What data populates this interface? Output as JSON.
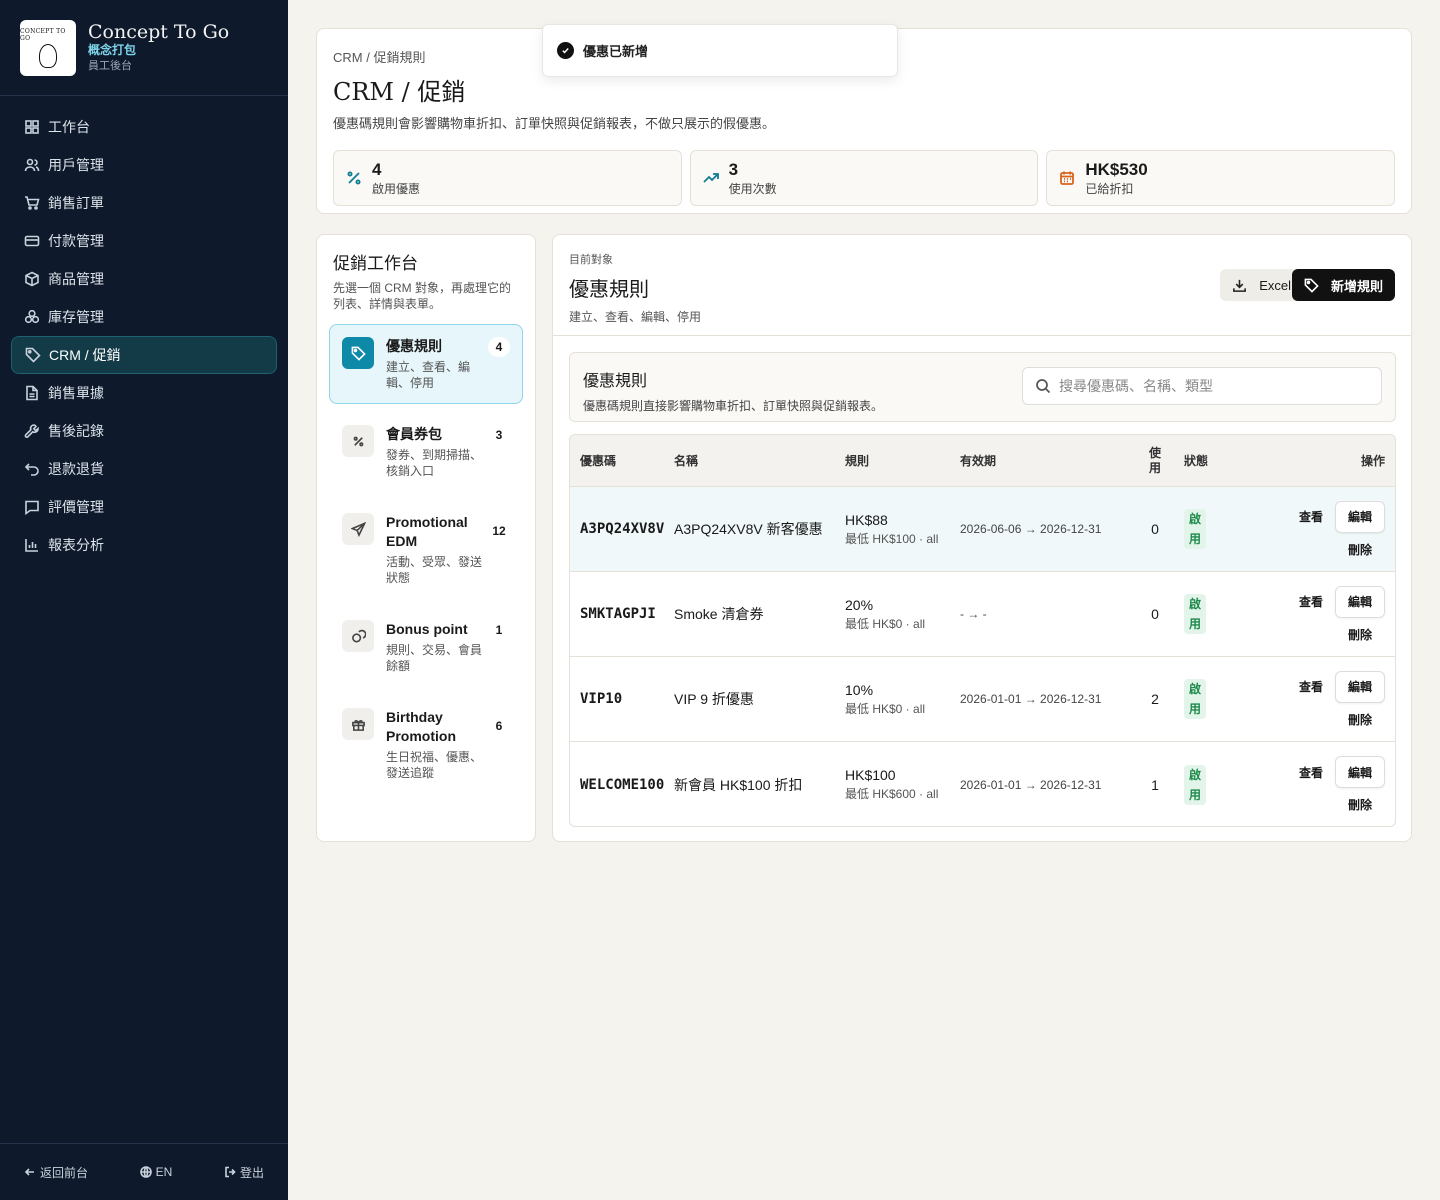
{
  "brand": {
    "logo_text": "CONCEPT TO GO",
    "title": "Concept To Go",
    "subtitle": "概念打包",
    "caption": "員工後台"
  },
  "nav": [
    {
      "label": "工作台",
      "icon": "dashboard-icon"
    },
    {
      "label": "用戶管理",
      "icon": "users-icon"
    },
    {
      "label": "銷售訂單",
      "icon": "cart-icon"
    },
    {
      "label": "付款管理",
      "icon": "credit-card-icon"
    },
    {
      "label": "商品管理",
      "icon": "package-icon"
    },
    {
      "label": "庫存管理",
      "icon": "boxes-icon"
    },
    {
      "label": "CRM / 促銷",
      "icon": "tag-icon",
      "active": true
    },
    {
      "label": "銷售單據",
      "icon": "file-icon"
    },
    {
      "label": "售後記錄",
      "icon": "wrench-icon"
    },
    {
      "label": "退款退貨",
      "icon": "undo-icon"
    },
    {
      "label": "評價管理",
      "icon": "message-icon"
    },
    {
      "label": "報表分析",
      "icon": "bar-chart-icon"
    }
  ],
  "footer": {
    "back": "返回前台",
    "lang": "EN",
    "logout": "登出"
  },
  "toast": {
    "message": "優惠已新增"
  },
  "header": {
    "breadcrumb": "CRM / 促銷規則",
    "title": "CRM / 促銷",
    "desc": "優惠碼規則會影響購物車折扣、訂單快照與促銷報表，不做只展示的假優惠。",
    "stats": [
      {
        "value": "4",
        "label": "啟用優惠",
        "icon": "percent-icon",
        "color": "#0e7c93"
      },
      {
        "value": "3",
        "label": "使用次數",
        "icon": "trending-up-icon",
        "color": "#0e7c93"
      },
      {
        "value": "HK$530",
        "label": "已給折扣",
        "icon": "calendar-icon",
        "color": "#d9641c"
      }
    ]
  },
  "workbench": {
    "title": "促銷工作台",
    "desc": "先選一個 CRM 對象，再處理它的列表、詳情與表單。",
    "items": [
      {
        "name": "優惠規則",
        "sub": "建立、查看、編輯、停用",
        "count": "4",
        "icon": "tag-icon",
        "active": true
      },
      {
        "name": "會員券包",
        "sub": "發券、到期掃描、核銷入口",
        "count": "3",
        "icon": "percent-icon"
      },
      {
        "name": "Promotional EDM",
        "sub": "活動、受眾、發送狀態",
        "count": "12",
        "icon": "send-icon"
      },
      {
        "name": "Bonus point",
        "sub": "規則、交易、會員餘額",
        "count": "1",
        "icon": "coins-icon"
      },
      {
        "name": "Birthday Promotion",
        "sub": "生日祝福、優惠、發送追蹤",
        "count": "6",
        "icon": "gift-icon"
      }
    ]
  },
  "rules": {
    "label": "目前對象",
    "title": "優惠規則",
    "desc": "建立、查看、編輯、停用",
    "excel": "Excel",
    "new_rule": "新增規則",
    "section_title": "優惠規則",
    "section_desc": "優惠碼規則直接影響購物車折扣、訂單快照與促銷報表。",
    "search_placeholder": "搜尋優惠碼、名稱、類型",
    "columns": [
      "優惠碼",
      "名稱",
      "規則",
      "有效期",
      "使用",
      "狀態",
      "操作"
    ],
    "actions": {
      "view": "查看",
      "edit": "編輯",
      "delete": "刪除"
    },
    "rows": [
      {
        "code": "A3PQ24XV8V",
        "name": "A3PQ24XV8V 新客優惠",
        "rule": "HK$88",
        "rule_sub": "最低 HK$100 · all",
        "period": "2026-06-06 → 2026-12-31",
        "used": "0",
        "status": "啟用"
      },
      {
        "code": "SMKTAGPJI",
        "name": "Smoke 清倉券",
        "rule": "20%",
        "rule_sub": "最低 HK$0 · all",
        "period": "- → -",
        "used": "0",
        "status": "啟用"
      },
      {
        "code": "VIP10",
        "name": "VIP 9 折優惠",
        "rule": "10%",
        "rule_sub": "最低 HK$0 · all",
        "period": "2026-01-01 → 2026-12-31",
        "used": "2",
        "status": "啟用"
      },
      {
        "code": "WELCOME100",
        "name": "新會員 HK$100 折扣",
        "rule": "HK$100",
        "rule_sub": "最低 HK$600 · all",
        "period": "2026-01-01 → 2026-12-31",
        "used": "1",
        "status": "啟用"
      }
    ]
  }
}
